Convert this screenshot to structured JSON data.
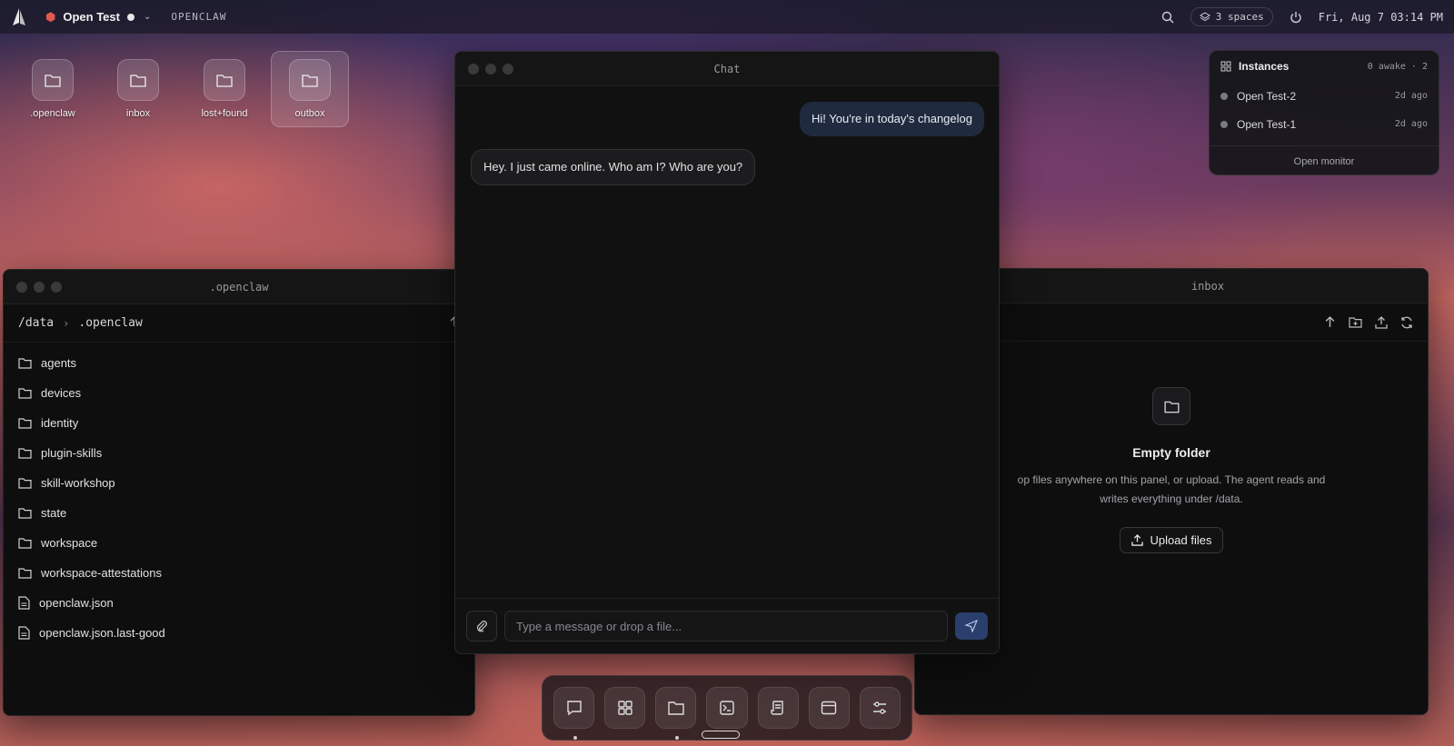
{
  "topbar": {
    "app_name": "Open Test",
    "space_label": "OPENCLAW",
    "spaces": "3 spaces",
    "clock": "Fri, Aug 7 03:14 PM"
  },
  "desktop": {
    "icons": [
      {
        "label": ".openclaw"
      },
      {
        "label": "inbox"
      },
      {
        "label": "lost+found"
      },
      {
        "label": "outbox"
      }
    ]
  },
  "instances": {
    "title": "Instances",
    "count": "0 awake · 2",
    "items": [
      {
        "name": "Open Test-2",
        "ago": "2d ago"
      },
      {
        "name": "Open Test-1",
        "ago": "2d ago"
      }
    ],
    "footer": "Open monitor"
  },
  "file_window": {
    "title": ".openclaw",
    "path_root": "/data",
    "path_current": ".openclaw",
    "items": [
      {
        "name": "agents",
        "type": "folder"
      },
      {
        "name": "devices",
        "type": "folder"
      },
      {
        "name": "identity",
        "type": "folder"
      },
      {
        "name": "plugin-skills",
        "type": "folder"
      },
      {
        "name": "skill-workshop",
        "type": "folder"
      },
      {
        "name": "state",
        "type": "folder"
      },
      {
        "name": "workspace",
        "type": "folder"
      },
      {
        "name": "workspace-attestations",
        "type": "folder"
      },
      {
        "name": "openclaw.json",
        "type": "file"
      },
      {
        "name": "openclaw.json.last-good",
        "type": "file"
      }
    ]
  },
  "inbox_window": {
    "title": "inbox",
    "empty_title": "Empty folder",
    "empty_desc_line1": "op files anywhere on this panel, or upload. The agent reads and",
    "empty_desc_line2": "writes everything under /data.",
    "upload_label": "Upload files"
  },
  "chat": {
    "title": "Chat",
    "messages": [
      {
        "role": "user",
        "text": "Hi! You're in today's changelog"
      },
      {
        "role": "bot",
        "text": "Hey. I just came online. Who am I? Who are you?"
      }
    ],
    "placeholder": "Type a message or drop a file..."
  },
  "dock": {
    "apps": [
      "chat-icon",
      "grid-icon",
      "folder-icon",
      "terminal-icon",
      "scroll-icon",
      "browser-icon",
      "settings-icon"
    ]
  }
}
